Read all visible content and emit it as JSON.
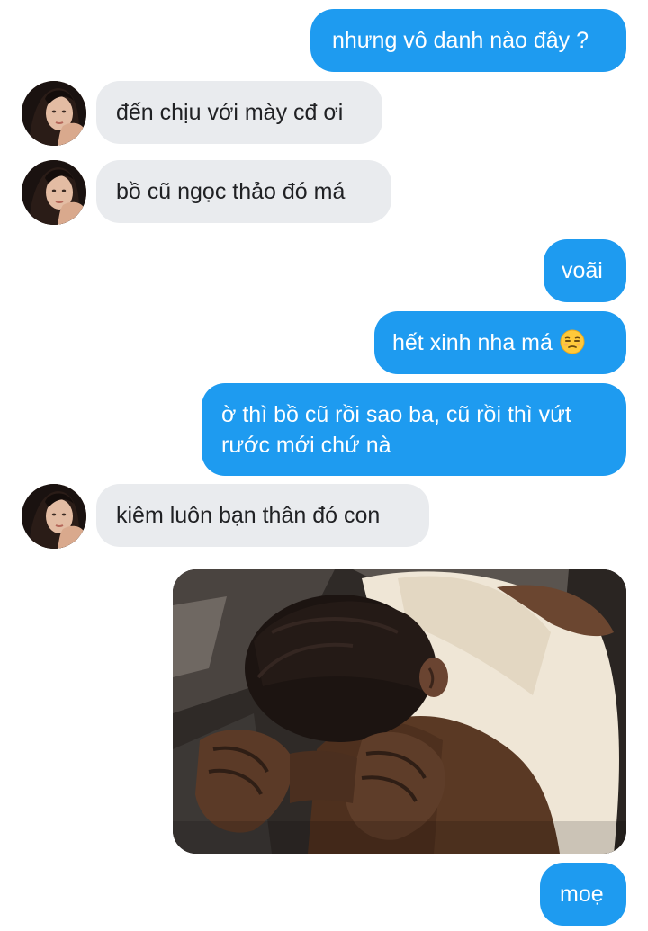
{
  "messages": [
    {
      "side": "sent",
      "text": "nhưng vô danh nào đây ?"
    },
    {
      "side": "recv",
      "text": "đến chịu với mày cđ ơi"
    },
    {
      "side": "recv",
      "text": "bồ cũ ngọc thảo đó má"
    },
    {
      "side": "sent",
      "text": "voãi"
    },
    {
      "side": "sent",
      "text": "hết xinh nha má",
      "emoji": "unamused-face-icon"
    },
    {
      "side": "sent",
      "text_line1": "ờ thì bồ cũ rồi sao ba, cũ rồi thì vứt",
      "text_line2": "rước mới chứ nà"
    },
    {
      "side": "recv",
      "text": "kiêm luôn bạn thân đó con"
    },
    {
      "side": "sent",
      "type": "image",
      "image": "man-covering-face-photo"
    },
    {
      "side": "sent",
      "text": "moẹ"
    }
  ],
  "colors": {
    "sent_bubble": "#1e9bf0",
    "recv_bubble": "#e9ebee",
    "background": "#ffffff"
  }
}
